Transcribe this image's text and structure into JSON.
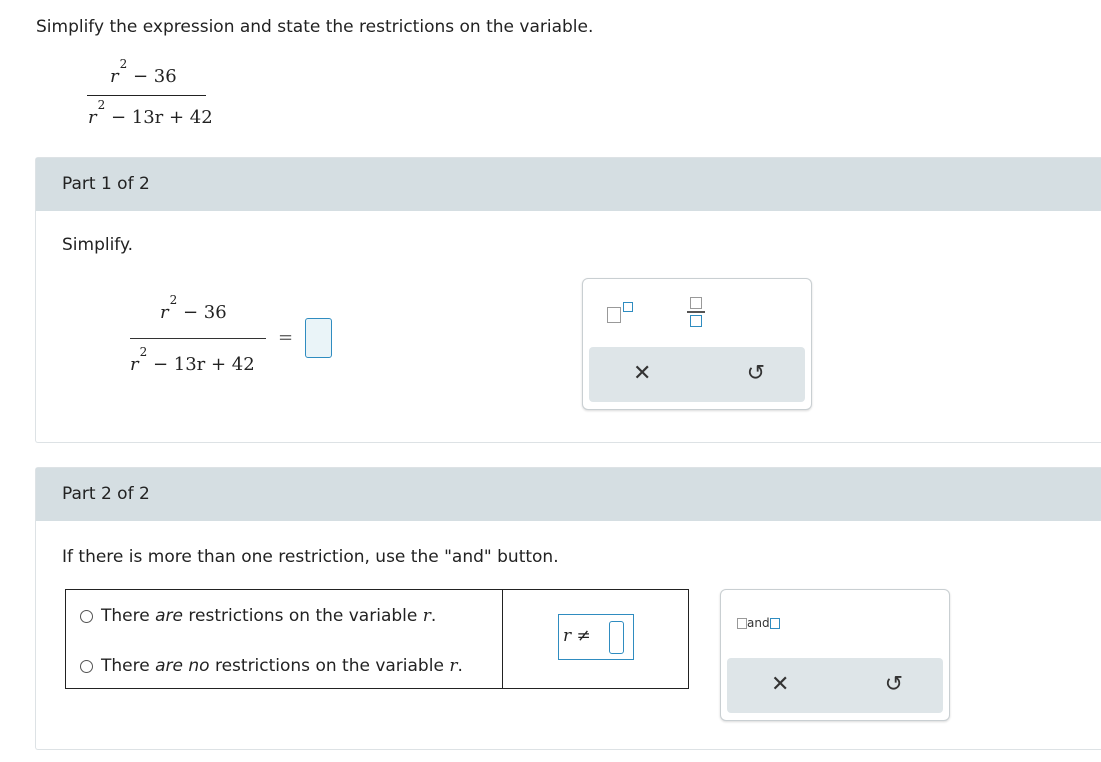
{
  "instruction": "Simplify the expression and state the restrictions on the variable.",
  "top_fraction": {
    "numerator": {
      "base": "r",
      "exp": "2",
      "rest": " − 36"
    },
    "denominator": {
      "base": "r",
      "exp": "2",
      "rest": " − 13r + 42"
    }
  },
  "part1": {
    "header": "Part 1 of 2",
    "prompt": "Simplify.",
    "fraction": {
      "numerator": {
        "base": "r",
        "exp": "2",
        "rest": " − 36"
      },
      "denominator": {
        "base": "r",
        "exp": "2",
        "rest": " − 13r + 42"
      }
    },
    "equals": "=",
    "toolbar": {
      "clear_symbol": "✕",
      "undo_symbol": "↺",
      "icons": [
        "exponent-template-icon",
        "fraction-template-icon",
        "clear-icon",
        "undo-icon"
      ]
    }
  },
  "part2": {
    "header": "Part 2 of 2",
    "note": "If there is more than one restriction, use the \"and\" button.",
    "options": [
      {
        "prefix": "There ",
        "emph": "are",
        "suffix": " restrictions on the variable ",
        "var": "r",
        "end": "."
      },
      {
        "prefix": "There ",
        "emph": "are no",
        "suffix": " restrictions on the variable ",
        "var": "r",
        "end": "."
      }
    ],
    "neq_expression": "r ≠",
    "toolbar": {
      "and_label": "and",
      "clear_symbol": "✕",
      "undo_symbol": "↺",
      "icons": [
        "and-template-icon",
        "clear-icon",
        "undo-icon"
      ]
    }
  },
  "colors": {
    "accent": "#2f8cc0",
    "header_bg": "#d5dee2",
    "action_bg": "#dee5e8"
  }
}
